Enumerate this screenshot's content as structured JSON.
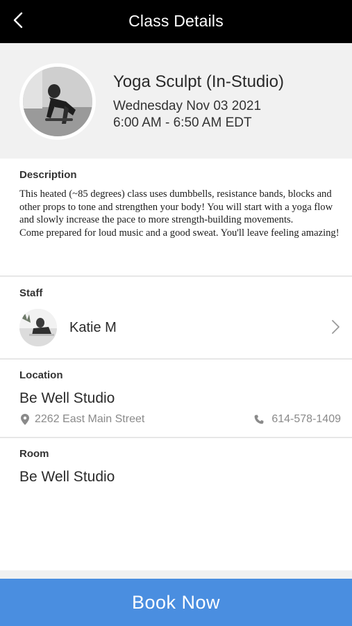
{
  "header": {
    "title": "Class Details",
    "back_icon": "chevron-left-icon"
  },
  "class": {
    "title": "Yoga Sculpt (In-Studio)",
    "date": "Wednesday Nov 03 2021",
    "time": "6:00 AM - 6:50 AM EDT"
  },
  "description": {
    "label": "Description",
    "paragraphs": [
      "This heated (~85 degrees) class uses dumbbells, resistance bands, blocks and other props to tone and strengthen your body! You will start with a yoga flow and slowly increase the pace to more strength-building movements.",
      "Come prepared for loud music and a good sweat. You'll leave feeling amazing!"
    ]
  },
  "staff": {
    "label": "Staff",
    "name": "Katie M"
  },
  "location": {
    "label": "Location",
    "name": "Be Well Studio",
    "address": "2262 East Main Street",
    "phone": "614-578-1409",
    "address_icon": "map-pin-icon",
    "phone_icon": "phone-icon"
  },
  "room": {
    "label": "Room",
    "name": "Be Well Studio"
  },
  "actions": {
    "book_label": "Book Now"
  },
  "colors": {
    "header_bg": "#000000",
    "hero_bg": "#f1f1f1",
    "accent": "#4a8ee0",
    "muted_text": "#8a8a8a"
  }
}
